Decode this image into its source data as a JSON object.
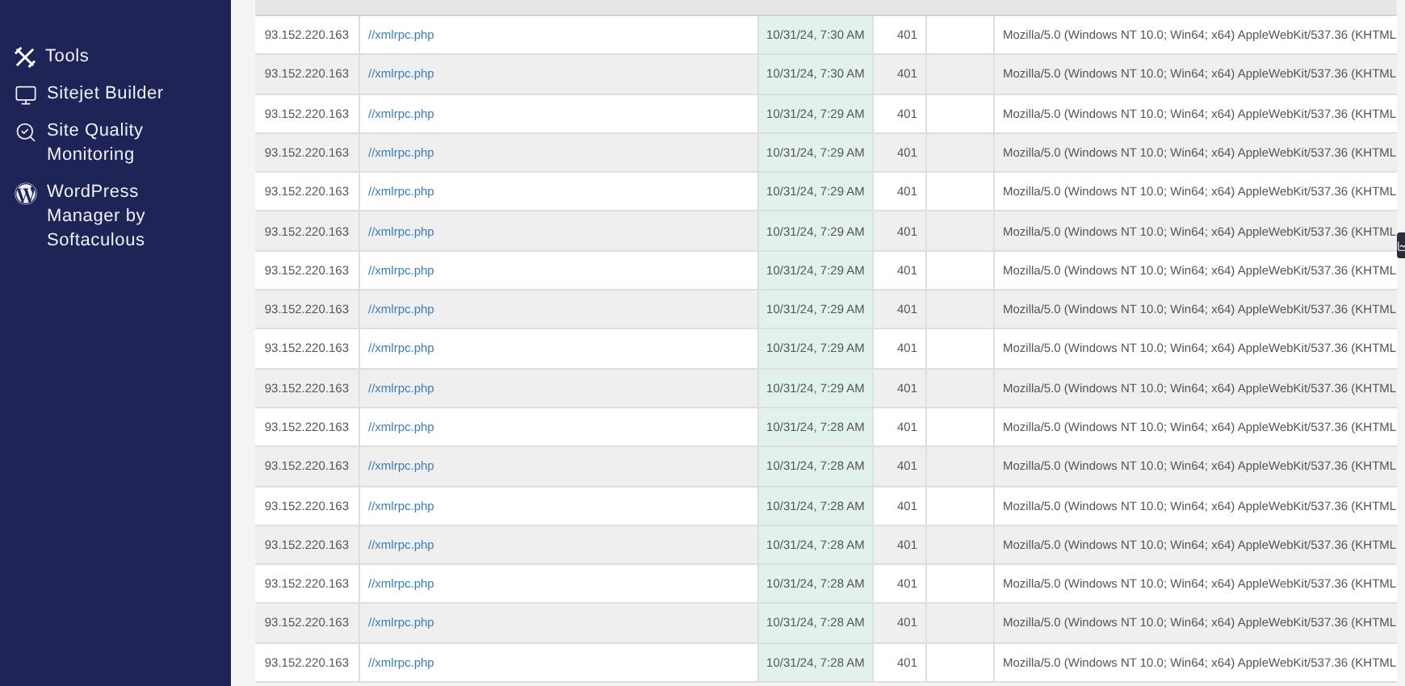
{
  "sidebar": {
    "items": [
      {
        "label": "Tools"
      },
      {
        "label": "Sitejet Builder"
      },
      {
        "label": "Site Quality Monitoring"
      },
      {
        "label": "WordPress Manager by Softaculous"
      }
    ]
  },
  "table": {
    "rows": [
      {
        "ip": "93.152.220.163",
        "url": "//xmlrpc.php",
        "time": "10/31/24, 7:30 AM",
        "code": "401",
        "agent": "Mozilla/5.0 (Windows NT 10.0; Win64; x64) AppleWebKit/537.36 (KHTML"
      },
      {
        "ip": "93.152.220.163",
        "url": "//xmlrpc.php",
        "time": "10/31/24, 7:30 AM",
        "code": "401",
        "agent": "Mozilla/5.0 (Windows NT 10.0; Win64; x64) AppleWebKit/537.36 (KHTML"
      },
      {
        "ip": "93.152.220.163",
        "url": "//xmlrpc.php",
        "time": "10/31/24, 7:29 AM",
        "code": "401",
        "agent": "Mozilla/5.0 (Windows NT 10.0; Win64; x64) AppleWebKit/537.36 (KHTML"
      },
      {
        "ip": "93.152.220.163",
        "url": "//xmlrpc.php",
        "time": "10/31/24, 7:29 AM",
        "code": "401",
        "agent": "Mozilla/5.0 (Windows NT 10.0; Win64; x64) AppleWebKit/537.36 (KHTML"
      },
      {
        "ip": "93.152.220.163",
        "url": "//xmlrpc.php",
        "time": "10/31/24, 7:29 AM",
        "code": "401",
        "agent": "Mozilla/5.0 (Windows NT 10.0; Win64; x64) AppleWebKit/537.36 (KHTML"
      },
      {
        "ip": "93.152.220.163",
        "url": "//xmlrpc.php",
        "time": "10/31/24, 7:29 AM",
        "code": "401",
        "agent": "Mozilla/5.0 (Windows NT 10.0; Win64; x64) AppleWebKit/537.36 (KHTML"
      },
      {
        "ip": "93.152.220.163",
        "url": "//xmlrpc.php",
        "time": "10/31/24, 7:29 AM",
        "code": "401",
        "agent": "Mozilla/5.0 (Windows NT 10.0; Win64; x64) AppleWebKit/537.36 (KHTML"
      },
      {
        "ip": "93.152.220.163",
        "url": "//xmlrpc.php",
        "time": "10/31/24, 7:29 AM",
        "code": "401",
        "agent": "Mozilla/5.0 (Windows NT 10.0; Win64; x64) AppleWebKit/537.36 (KHTML"
      },
      {
        "ip": "93.152.220.163",
        "url": "//xmlrpc.php",
        "time": "10/31/24, 7:29 AM",
        "code": "401",
        "agent": "Mozilla/5.0 (Windows NT 10.0; Win64; x64) AppleWebKit/537.36 (KHTML"
      },
      {
        "ip": "93.152.220.163",
        "url": "//xmlrpc.php",
        "time": "10/31/24, 7:29 AM",
        "code": "401",
        "agent": "Mozilla/5.0 (Windows NT 10.0; Win64; x64) AppleWebKit/537.36 (KHTML"
      },
      {
        "ip": "93.152.220.163",
        "url": "//xmlrpc.php",
        "time": "10/31/24, 7:28 AM",
        "code": "401",
        "agent": "Mozilla/5.0 (Windows NT 10.0; Win64; x64) AppleWebKit/537.36 (KHTML"
      },
      {
        "ip": "93.152.220.163",
        "url": "//xmlrpc.php",
        "time": "10/31/24, 7:28 AM",
        "code": "401",
        "agent": "Mozilla/5.0 (Windows NT 10.0; Win64; x64) AppleWebKit/537.36 (KHTML"
      },
      {
        "ip": "93.152.220.163",
        "url": "//xmlrpc.php",
        "time": "10/31/24, 7:28 AM",
        "code": "401",
        "agent": "Mozilla/5.0 (Windows NT 10.0; Win64; x64) AppleWebKit/537.36 (KHTML"
      },
      {
        "ip": "93.152.220.163",
        "url": "//xmlrpc.php",
        "time": "10/31/24, 7:28 AM",
        "code": "401",
        "agent": "Mozilla/5.0 (Windows NT 10.0; Win64; x64) AppleWebKit/537.36 (KHTML"
      },
      {
        "ip": "93.152.220.163",
        "url": "//xmlrpc.php",
        "time": "10/31/24, 7:28 AM",
        "code": "401",
        "agent": "Mozilla/5.0 (Windows NT 10.0; Win64; x64) AppleWebKit/537.36 (KHTML"
      },
      {
        "ip": "93.152.220.163",
        "url": "//xmlrpc.php",
        "time": "10/31/24, 7:28 AM",
        "code": "401",
        "agent": "Mozilla/5.0 (Windows NT 10.0; Win64; x64) AppleWebKit/537.36 (KHTML"
      },
      {
        "ip": "93.152.220.163",
        "url": "//xmlrpc.php",
        "time": "10/31/24, 7:28 AM",
        "code": "401",
        "agent": "Mozilla/5.0 (Windows NT 10.0; Win64; x64) AppleWebKit/537.36 (KHTML"
      }
    ]
  }
}
